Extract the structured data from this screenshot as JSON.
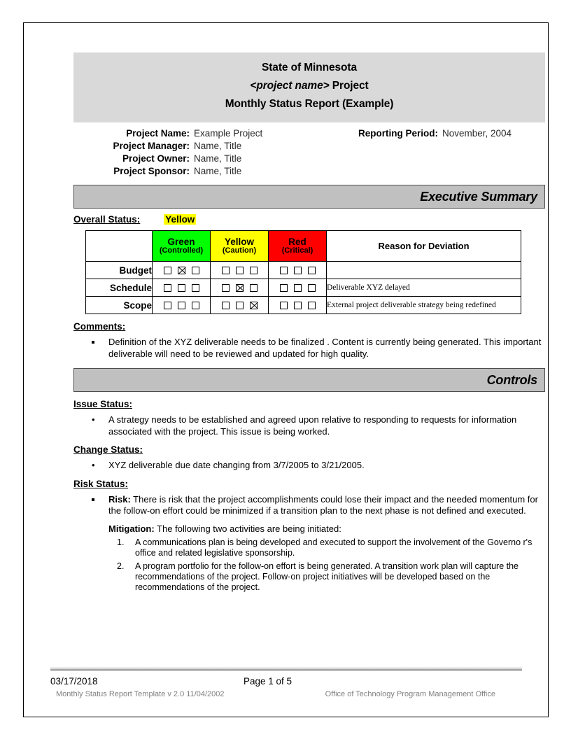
{
  "document": {
    "title_lines": [
      {
        "text": "State of Minnesota",
        "italic_part": ""
      },
      {
        "text": " Project",
        "italic_part": "<project name>"
      },
      {
        "text": "Monthly Status Report (Example)",
        "italic_part": ""
      }
    ],
    "line1": "State of Minnesota",
    "line2_italic": "<project name>",
    "line2_rest": " Project",
    "line3": "Monthly Status Report (Example)"
  },
  "project_info": {
    "project_name_label": "Project Name:",
    "project_name_value": "Example Project",
    "project_manager_label": "Project Manager:",
    "project_manager_value": "Name, Title",
    "project_owner_label": "Project Owner:",
    "project_owner_value": "Name, Title",
    "project_sponsor_label": "Project Sponsor:",
    "project_sponsor_value": "Name, Title",
    "reporting_period_label": "Reporting Period:",
    "reporting_period_value": "November, 2004"
  },
  "executive_summary": {
    "bar_title": "Executive Summary",
    "overall_status_label": "Overall Status:",
    "overall_status_value": "Yellow",
    "overall_status_color": "#ffff00"
  },
  "status_table": {
    "headers": [
      {
        "main": "",
        "sub": "",
        "color": "#ffffff"
      },
      {
        "main": "Green",
        "sub": "(Controlled)",
        "color": "#00ff00"
      },
      {
        "main": "Yellow",
        "sub": "(Caution)",
        "color": "#ffff00"
      },
      {
        "main": "Red",
        "sub": "(Critical)",
        "color": "#ff0000"
      },
      {
        "main": "Reason for Deviation",
        "sub": "",
        "color": "#ffffff"
      }
    ],
    "reason_header": "Reason for Deviation",
    "rows": [
      {
        "label": "Budget",
        "green": [
          false,
          true,
          false
        ],
        "yellow": [
          false,
          false,
          false
        ],
        "red": [
          false,
          false,
          false
        ],
        "reason": ""
      },
      {
        "label": "Schedule",
        "green": [
          false,
          false,
          false
        ],
        "yellow": [
          false,
          true,
          false
        ],
        "red": [
          false,
          false,
          false
        ],
        "reason": "Deliverable  XYZ delayed"
      },
      {
        "label": "Scope",
        "green": [
          false,
          false,
          false
        ],
        "yellow": [
          false,
          false,
          true
        ],
        "red": [
          false,
          false,
          false
        ],
        "reason": "External project deliverable strategy being redefined"
      }
    ]
  },
  "comments": {
    "heading": "Comments:",
    "items": [
      "Definition of the  XYZ  deliverable  needs to be finalized .  Content is currently being generated.  This important deliverable will need to be reviewed and updated for high quality."
    ]
  },
  "controls": {
    "bar_title": "Controls",
    "issue_status": {
      "heading": "Issue Status:",
      "items": [
        "A strategy needs to be established  and agreed upon relative to   responding to  requests for information associated with the project.  This issue is being worked."
      ]
    },
    "change_status": {
      "heading": "Change Status:",
      "items": [
        "XYZ  deliverable due date changing from   3/7/2005 to 3/21/2005."
      ]
    },
    "risk_status": {
      "heading": "Risk Status:",
      "risk_label": "Risk:",
      "risk_text": " There is risk that the  project  accomplishments could lose their impact and the needed momentum for the follow-on effort could be   minimized if a transition plan to the next phase is not defined and executed.",
      "mitigation_label": "Mitigation:",
      "mitigation_text": "  The following two activities are being initiated:",
      "mitigation_items": [
        {
          "num": "1.",
          "text": "A communications plan is being developed and executed to support the involvement of the Governo r's office and related legislative sponsorship."
        },
        {
          "num": "2.",
          "text": "A program portfolio for the follow-on effort is being generated. A transition work plan will capture the recommendations of the project. Follow-on project initiatives will be developed based on the recommendations of the project."
        }
      ]
    }
  },
  "footer": {
    "date": "03/17/2018",
    "page": "Page 1 of 5",
    "template": "Monthly Status Report Template  v 2.0  11/04/2002",
    "office": "Office of Technology Program Management Office"
  }
}
